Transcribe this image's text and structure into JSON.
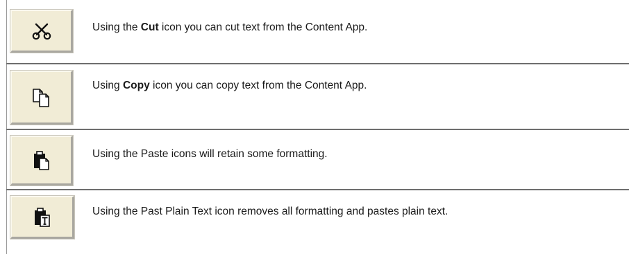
{
  "rows": [
    {
      "icon": "scissors-icon",
      "prefix": "Using the ",
      "bold": "Cut",
      "suffix": " icon you can cut text from the Content App."
    },
    {
      "icon": "copy-icon",
      "prefix": "Using ",
      "bold": "Copy",
      "suffix": " icon you can copy text from the Content App."
    },
    {
      "icon": "paste-icon",
      "prefix": "Using the Paste icons will retain some formatting.",
      "bold": "",
      "suffix": ""
    },
    {
      "icon": "paste-plain-text-icon",
      "prefix": "Using the Past Plain Text icon removes all formatting and pastes plain text.",
      "bold": "",
      "suffix": ""
    }
  ],
  "colors": {
    "button_face": "#f1ecd6",
    "rule": "#6e6e6e",
    "text": "#1a1a1a"
  }
}
